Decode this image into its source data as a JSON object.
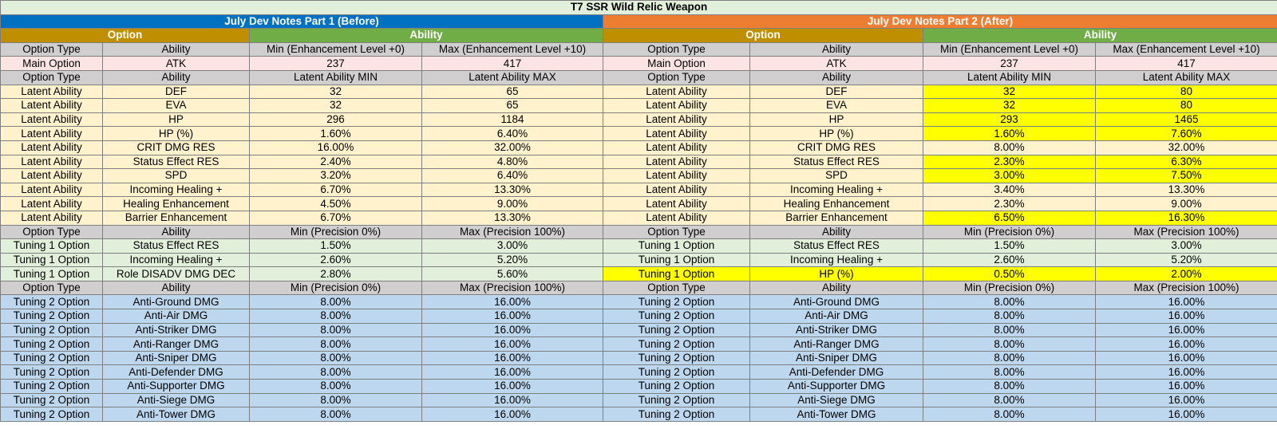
{
  "title": "T7 SSR Wild Relic Weapon",
  "before_label": "July Dev Notes Part 1 (Before)",
  "after_label": "July Dev Notes Part 2 (After)",
  "option_label": "Option",
  "ability_label": "Ability",
  "colors": {
    "before": "#0070c0",
    "after": "#ed7d31",
    "option": "#bf8f00",
    "ability": "#70ad47",
    "highlight": "#ffff00"
  },
  "rows": [
    {
      "type": "hdr",
      "before": [
        "Option Type",
        "Ability",
        "Min (Enhancement Level +0)",
        "Max (Enhancement Level +10)"
      ],
      "after": [
        "Option Type",
        "Ability",
        "Min (Enhancement Level +0)",
        "Max (Enhancement Level +10)"
      ],
      "hl": []
    },
    {
      "type": "main",
      "before": [
        "Main Option",
        "ATK",
        "237",
        "417"
      ],
      "after": [
        "Main Option",
        "ATK",
        "237",
        "417"
      ],
      "hl": []
    },
    {
      "type": "hdr",
      "before": [
        "Option Type",
        "Ability",
        "Latent Ability MIN",
        "Latent Ability MAX"
      ],
      "after": [
        "Option Type",
        "Ability",
        "Latent Ability MIN",
        "Latent Ability MAX"
      ],
      "hl": []
    },
    {
      "type": "latent",
      "before": [
        "Latent Ability",
        "DEF",
        "32",
        "65"
      ],
      "after": [
        "Latent Ability",
        "DEF",
        "32",
        "80"
      ],
      "hl": [
        2,
        3
      ]
    },
    {
      "type": "latent",
      "before": [
        "Latent Ability",
        "EVA",
        "32",
        "65"
      ],
      "after": [
        "Latent Ability",
        "EVA",
        "32",
        "80"
      ],
      "hl": [
        2,
        3
      ]
    },
    {
      "type": "latent",
      "before": [
        "Latent Ability",
        "HP",
        "296",
        "1184"
      ],
      "after": [
        "Latent Ability",
        "HP",
        "293",
        "1465"
      ],
      "hl": [
        2,
        3
      ]
    },
    {
      "type": "latent",
      "before": [
        "Latent Ability",
        "HP (%)",
        "1.60%",
        "6.40%"
      ],
      "after": [
        "Latent Ability",
        "HP (%)",
        "1.60%",
        "7.60%"
      ],
      "hl": [
        2,
        3
      ]
    },
    {
      "type": "latent",
      "before": [
        "Latent Ability",
        "CRIT DMG RES",
        "16.00%",
        "32.00%"
      ],
      "after": [
        "Latent Ability",
        "CRIT DMG RES",
        "8.00%",
        "32.00%"
      ],
      "hl": []
    },
    {
      "type": "latent",
      "before": [
        "Latent Ability",
        "Status Effect RES",
        "2.40%",
        "4.80%"
      ],
      "after": [
        "Latent Ability",
        "Status Effect RES",
        "2.30%",
        "6.30%"
      ],
      "hl": [
        2,
        3
      ]
    },
    {
      "type": "latent",
      "before": [
        "Latent Ability",
        "SPD",
        "3.20%",
        "6.40%"
      ],
      "after": [
        "Latent Ability",
        "SPD",
        "3.00%",
        "7.50%"
      ],
      "hl": [
        2,
        3
      ]
    },
    {
      "type": "latent",
      "before": [
        "Latent Ability",
        "Incoming Healing +",
        "6.70%",
        "13.30%"
      ],
      "after": [
        "Latent Ability",
        "Incoming Healing +",
        "3.40%",
        "13.30%"
      ],
      "hl": []
    },
    {
      "type": "latent",
      "before": [
        "Latent Ability",
        "Healing Enhancement",
        "4.50%",
        "9.00%"
      ],
      "after": [
        "Latent Ability",
        "Healing Enhancement",
        "2.30%",
        "9.00%"
      ],
      "hl": []
    },
    {
      "type": "latent",
      "before": [
        "Latent Ability",
        "Barrier Enhancement",
        "6.70%",
        "13.30%"
      ],
      "after": [
        "Latent Ability",
        "Barrier Enhancement",
        "6.50%",
        "16.30%"
      ],
      "hl": [
        2,
        3
      ]
    },
    {
      "type": "hdr",
      "before": [
        "Option Type",
        "Ability",
        "Min (Precision 0%)",
        "Max (Precision 100%)"
      ],
      "after": [
        "Option Type",
        "Ability",
        "Min (Precision 0%)",
        "Max (Precision 100%)"
      ],
      "hl": []
    },
    {
      "type": "t1",
      "before": [
        "Tuning 1 Option",
        "Status Effect RES",
        "1.50%",
        "3.00%"
      ],
      "after": [
        "Tuning 1 Option",
        "Status Effect RES",
        "1.50%",
        "3.00%"
      ],
      "hl": []
    },
    {
      "type": "t1",
      "before": [
        "Tuning 1 Option",
        "Incoming Healing +",
        "2.60%",
        "5.20%"
      ],
      "after": [
        "Tuning 1 Option",
        "Incoming Healing +",
        "2.60%",
        "5.20%"
      ],
      "hl": []
    },
    {
      "type": "t1",
      "before": [
        "Tuning 1 Option",
        "Role DISADV DMG DEC",
        "2.80%",
        "5.60%"
      ],
      "after": [
        "Tuning 1 Option",
        "HP (%)",
        "0.50%",
        "2.00%"
      ],
      "hl": [
        0,
        1,
        2,
        3
      ]
    },
    {
      "type": "hdr",
      "before": [
        "Option Type",
        "Ability",
        "Min (Precision 0%)",
        "Max (Precision 100%)"
      ],
      "after": [
        "Option Type",
        "Ability",
        "Min (Precision 0%)",
        "Max (Precision 100%)"
      ],
      "hl": []
    },
    {
      "type": "t2",
      "before": [
        "Tuning 2 Option",
        "Anti-Ground DMG",
        "8.00%",
        "16.00%"
      ],
      "after": [
        "Tuning 2 Option",
        "Anti-Ground DMG",
        "8.00%",
        "16.00%"
      ],
      "hl": []
    },
    {
      "type": "t2",
      "before": [
        "Tuning 2 Option",
        "Anti-Air DMG",
        "8.00%",
        "16.00%"
      ],
      "after": [
        "Tuning 2 Option",
        "Anti-Air DMG",
        "8.00%",
        "16.00%"
      ],
      "hl": []
    },
    {
      "type": "t2",
      "before": [
        "Tuning 2 Option",
        "Anti-Striker DMG",
        "8.00%",
        "16.00%"
      ],
      "after": [
        "Tuning 2 Option",
        "Anti-Striker DMG",
        "8.00%",
        "16.00%"
      ],
      "hl": []
    },
    {
      "type": "t2",
      "before": [
        "Tuning 2 Option",
        "Anti-Ranger DMG",
        "8.00%",
        "16.00%"
      ],
      "after": [
        "Tuning 2 Option",
        "Anti-Ranger DMG",
        "8.00%",
        "16.00%"
      ],
      "hl": []
    },
    {
      "type": "t2",
      "before": [
        "Tuning 2 Option",
        "Anti-Sniper DMG",
        "8.00%",
        "16.00%"
      ],
      "after": [
        "Tuning 2 Option",
        "Anti-Sniper DMG",
        "8.00%",
        "16.00%"
      ],
      "hl": []
    },
    {
      "type": "t2",
      "before": [
        "Tuning 2 Option",
        "Anti-Defender DMG",
        "8.00%",
        "16.00%"
      ],
      "after": [
        "Tuning 2 Option",
        "Anti-Defender DMG",
        "8.00%",
        "16.00%"
      ],
      "hl": []
    },
    {
      "type": "t2",
      "before": [
        "Tuning 2 Option",
        "Anti-Supporter DMG",
        "8.00%",
        "16.00%"
      ],
      "after": [
        "Tuning 2 Option",
        "Anti-Supporter DMG",
        "8.00%",
        "16.00%"
      ],
      "hl": []
    },
    {
      "type": "t2",
      "before": [
        "Tuning 2 Option",
        "Anti-Siege DMG",
        "8.00%",
        "16.00%"
      ],
      "after": [
        "Tuning 2 Option",
        "Anti-Siege DMG",
        "8.00%",
        "16.00%"
      ],
      "hl": []
    },
    {
      "type": "t2",
      "before": [
        "Tuning 2 Option",
        "Anti-Tower DMG",
        "8.00%",
        "16.00%"
      ],
      "after": [
        "Tuning 2 Option",
        "Anti-Tower DMG",
        "8.00%",
        "16.00%"
      ],
      "hl": []
    }
  ]
}
